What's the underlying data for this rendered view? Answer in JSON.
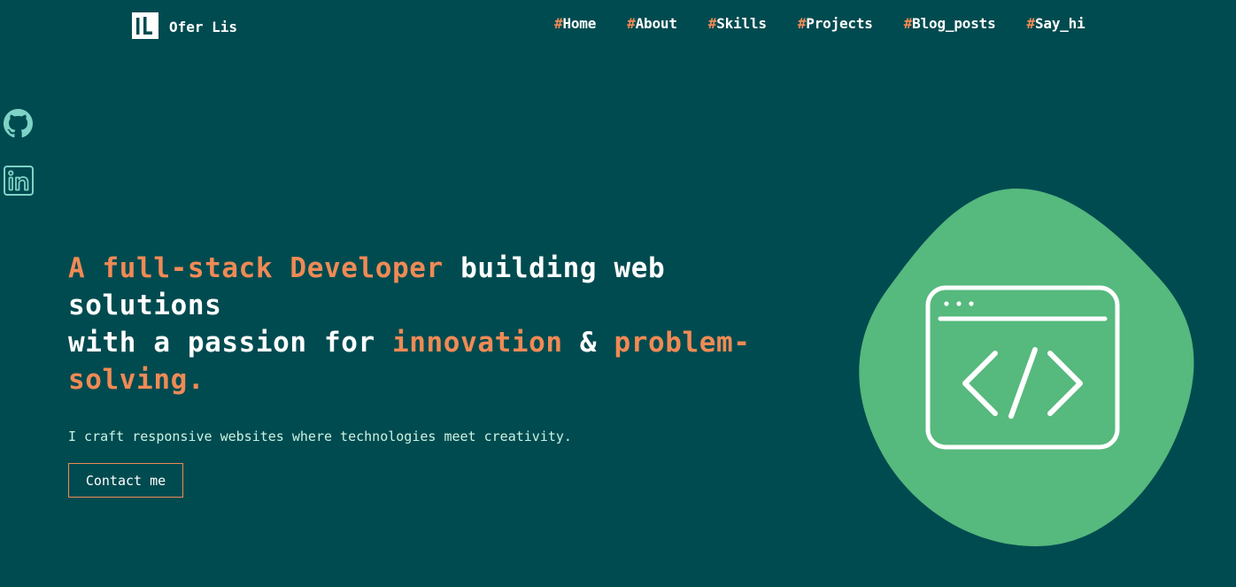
{
  "brand": {
    "name": "Ofer Lis"
  },
  "nav": {
    "items": [
      {
        "hash": "#",
        "label": "Home"
      },
      {
        "hash": "#",
        "label": "About"
      },
      {
        "hash": "#",
        "label": "Skills"
      },
      {
        "hash": "#",
        "label": "Projects"
      },
      {
        "hash": "#",
        "label": "Blog_posts"
      },
      {
        "hash": "#",
        "label": "Say_hi"
      }
    ]
  },
  "social": {
    "icons": [
      "github-icon",
      "linkedin-icon"
    ]
  },
  "hero": {
    "title_part1": "A full-stack Developer",
    "title_part2": " building web solutions",
    "title_part3": "with a passion for ",
    "title_part4": "innovation",
    "title_part5": " & ",
    "title_part6": "problem-solving."
  },
  "tagline": "I craft responsive websites where technologies meet creativity.",
  "cta": {
    "label": "Contact me"
  },
  "illustration": {
    "icon": "code-window-icon"
  },
  "colors": {
    "background": "#004b50",
    "accent": "#f08a55",
    "blob": "#56b97d",
    "text": "#ffffff",
    "social": "#7fd3c6"
  }
}
